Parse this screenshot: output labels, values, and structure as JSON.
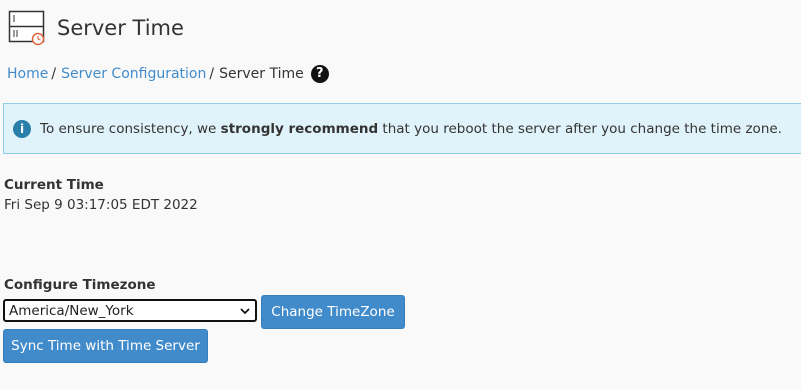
{
  "header": {
    "title": "Server Time",
    "icon": "server-clock-icon"
  },
  "breadcrumb": {
    "home": "Home",
    "sep1": "/",
    "section": "Server Configuration",
    "sep2": "/",
    "current": "Server Time",
    "help_icon": "question-circle-icon",
    "help_glyph": "?"
  },
  "alert": {
    "icon": "info-icon",
    "icon_glyph": "i",
    "text_before": "To ensure consistency, we ",
    "text_strong": "strongly recommend",
    "text_after": " that you reboot the server after you change the time zone."
  },
  "current_time": {
    "label": "Current Time",
    "value": "Fri Sep 9 03:17:05 EDT 2022"
  },
  "timezone": {
    "label": "Configure Timezone",
    "selected": "America/New_York",
    "change_button": "Change TimeZone",
    "sync_button": "Sync Time with Time Server"
  },
  "colors": {
    "link": "#428bca",
    "button": "#428bca",
    "alert_bg": "#e1f3fa",
    "alert_border": "#8ecde8",
    "clock_accent": "#e0643c"
  }
}
